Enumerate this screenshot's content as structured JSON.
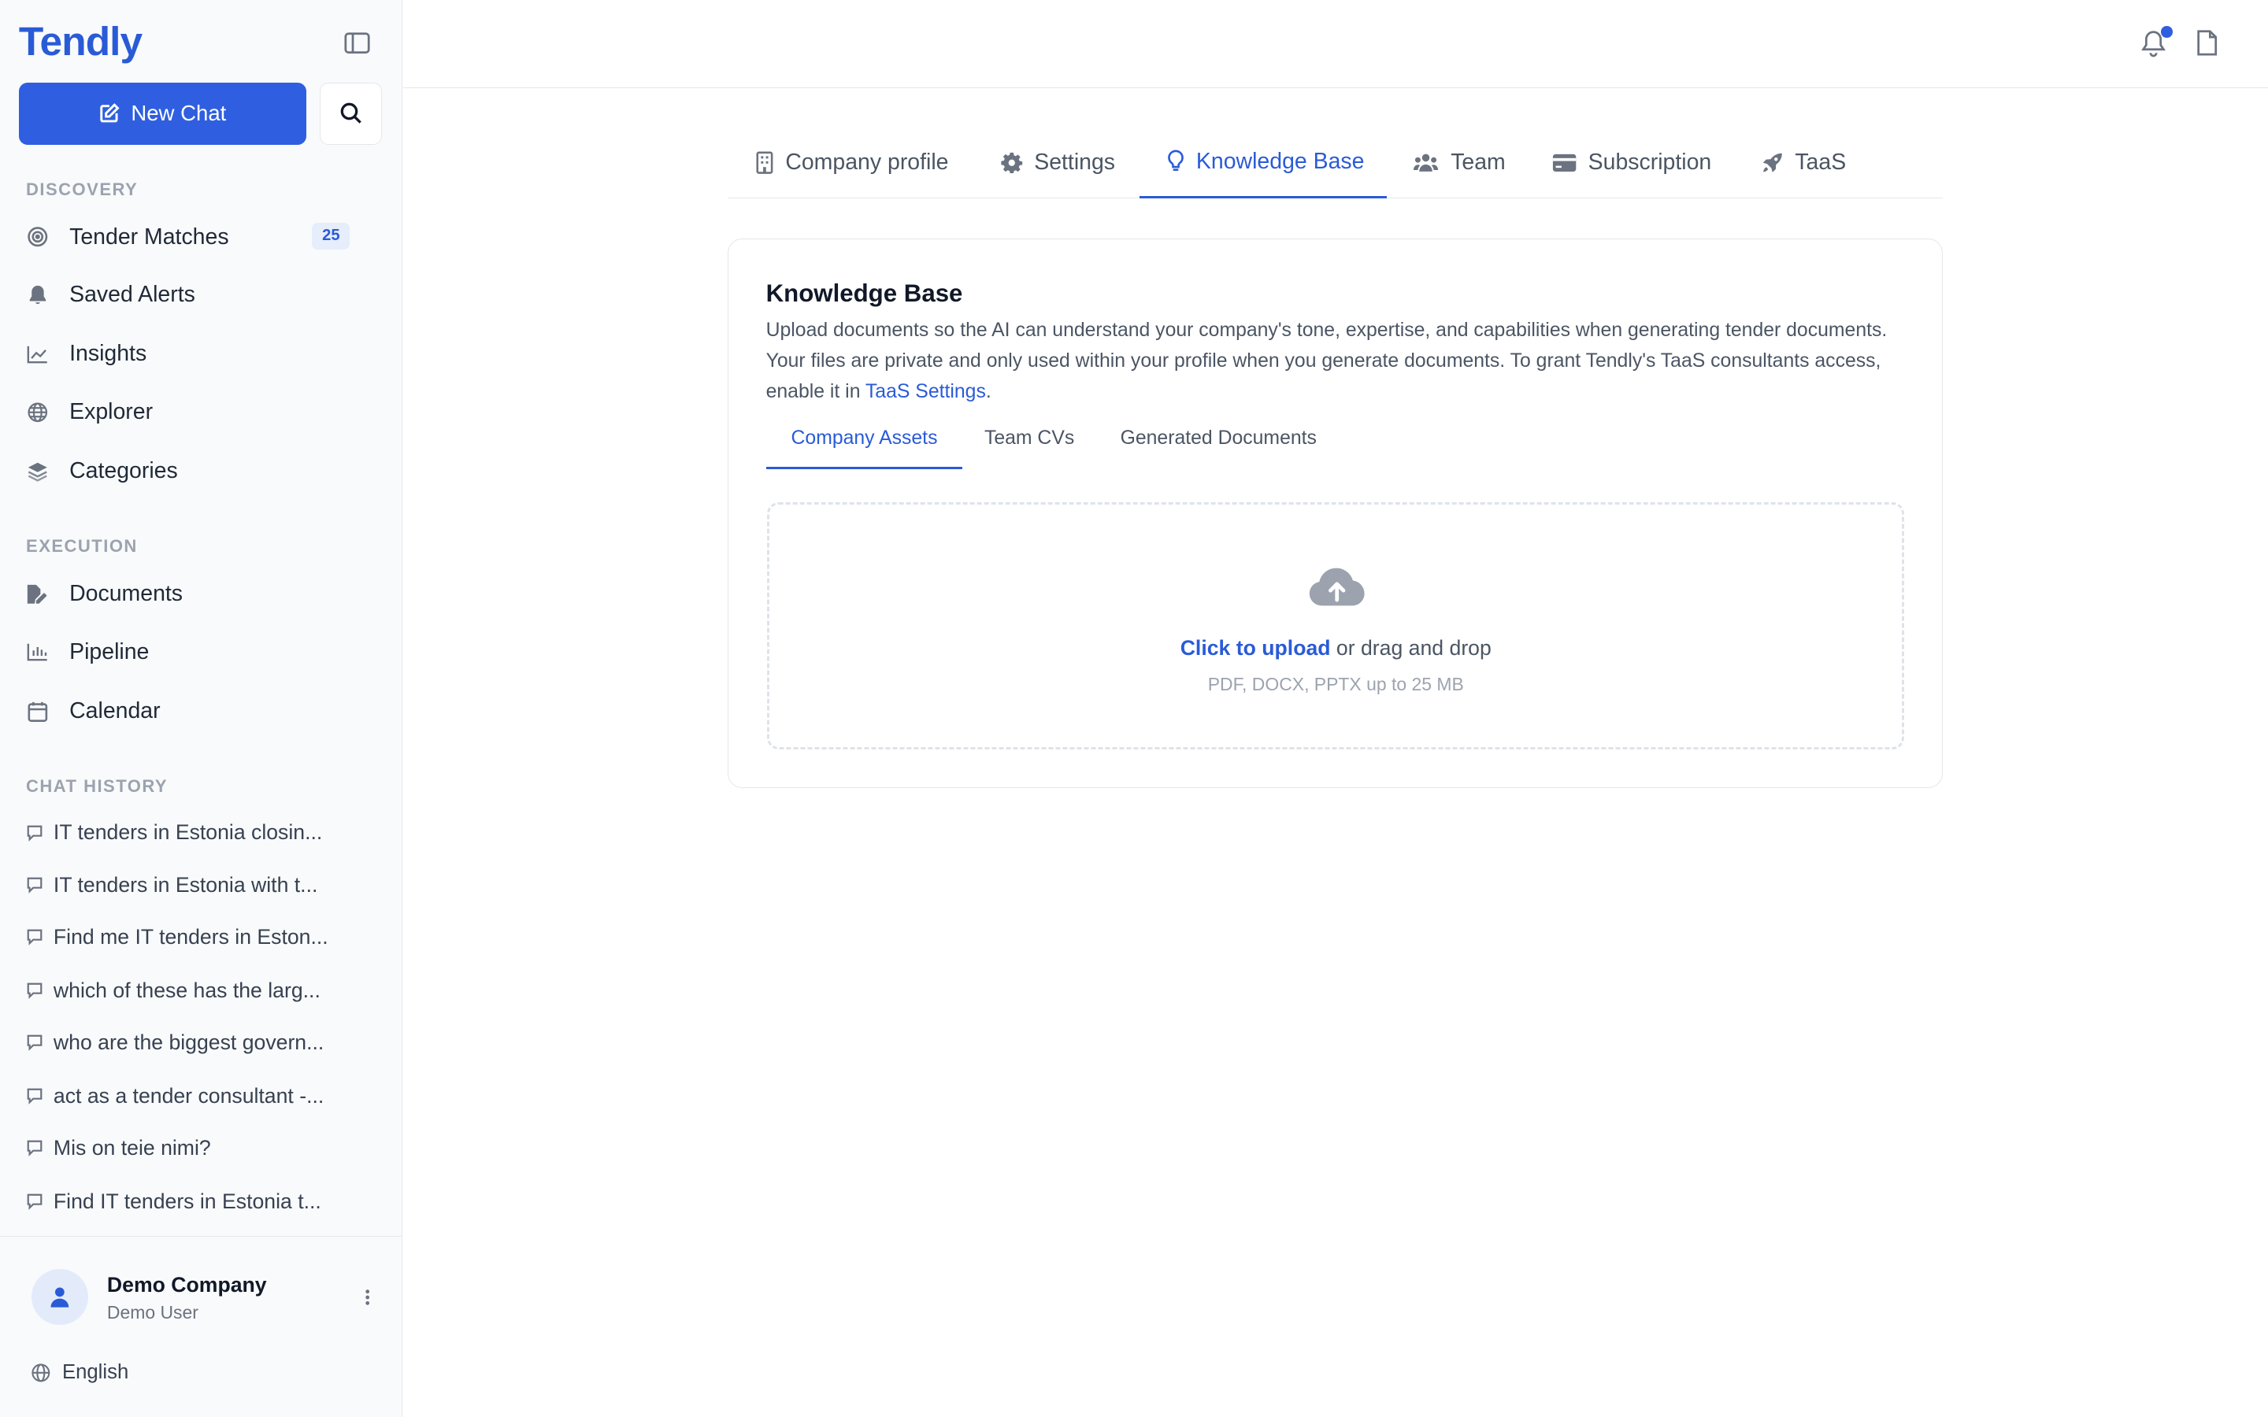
{
  "app": {
    "name": "Tendly"
  },
  "sidebar": {
    "new_chat_label": "New Chat",
    "discovery_label": "DISCOVERY",
    "discovery_items": [
      {
        "label": "Tender Matches",
        "icon": "target-icon",
        "badge": "25"
      },
      {
        "label": "Saved Alerts",
        "icon": "bell-icon"
      },
      {
        "label": "Insights",
        "icon": "line-chart-icon"
      },
      {
        "label": "Explorer",
        "icon": "globe-icon"
      },
      {
        "label": "Categories",
        "icon": "layers-icon"
      }
    ],
    "execution_label": "EXECUTION",
    "execution_items": [
      {
        "label": "Documents",
        "icon": "file-edit-icon"
      },
      {
        "label": "Pipeline",
        "icon": "bar-chart-icon"
      },
      {
        "label": "Calendar",
        "icon": "calendar-icon"
      }
    ],
    "chat_history_label": "CHAT HISTORY",
    "chat_history": [
      "IT tenders in Estonia closin...",
      "IT tenders in Estonia with t...",
      "Find me IT tenders in Eston...",
      "which of these has the larg...",
      "who are the biggest govern...",
      "act as a tender consultant -...",
      "Mis on teie nimi?",
      "Find IT tenders in Estonia t..."
    ],
    "user": {
      "name": "Demo Company",
      "role": "Demo User"
    },
    "language": "English"
  },
  "tabs": [
    {
      "label": "Company profile",
      "icon": "building-icon"
    },
    {
      "label": "Settings",
      "icon": "gear-icon"
    },
    {
      "label": "Knowledge Base",
      "icon": "lightbulb-icon",
      "active": true
    },
    {
      "label": "Team",
      "icon": "users-icon"
    },
    {
      "label": "Subscription",
      "icon": "credit-card-icon"
    },
    {
      "label": "TaaS",
      "icon": "rocket-icon"
    }
  ],
  "knowledge_base": {
    "title": "Knowledge Base",
    "description_before_link": "Upload documents so the AI can understand your company's tone, expertise, and capabilities when generating tender documents. Your files are private and only used within your profile when you generate documents. To grant Tendly's TaaS consultants access, enable it in ",
    "description_link": "TaaS Settings",
    "description_after_link": ".",
    "subtabs": [
      {
        "label": "Company Assets",
        "active": true
      },
      {
        "label": "Team CVs"
      },
      {
        "label": "Generated Documents"
      }
    ],
    "upload": {
      "link_text": "Click to upload",
      "rest_text": " or drag and drop",
      "hint": "PDF, DOCX, PPTX up to 25 MB"
    }
  },
  "colors": {
    "accent": "#2f5fe0",
    "link": "#2a5bd7",
    "sidebar_bg": "#f9fafb"
  }
}
